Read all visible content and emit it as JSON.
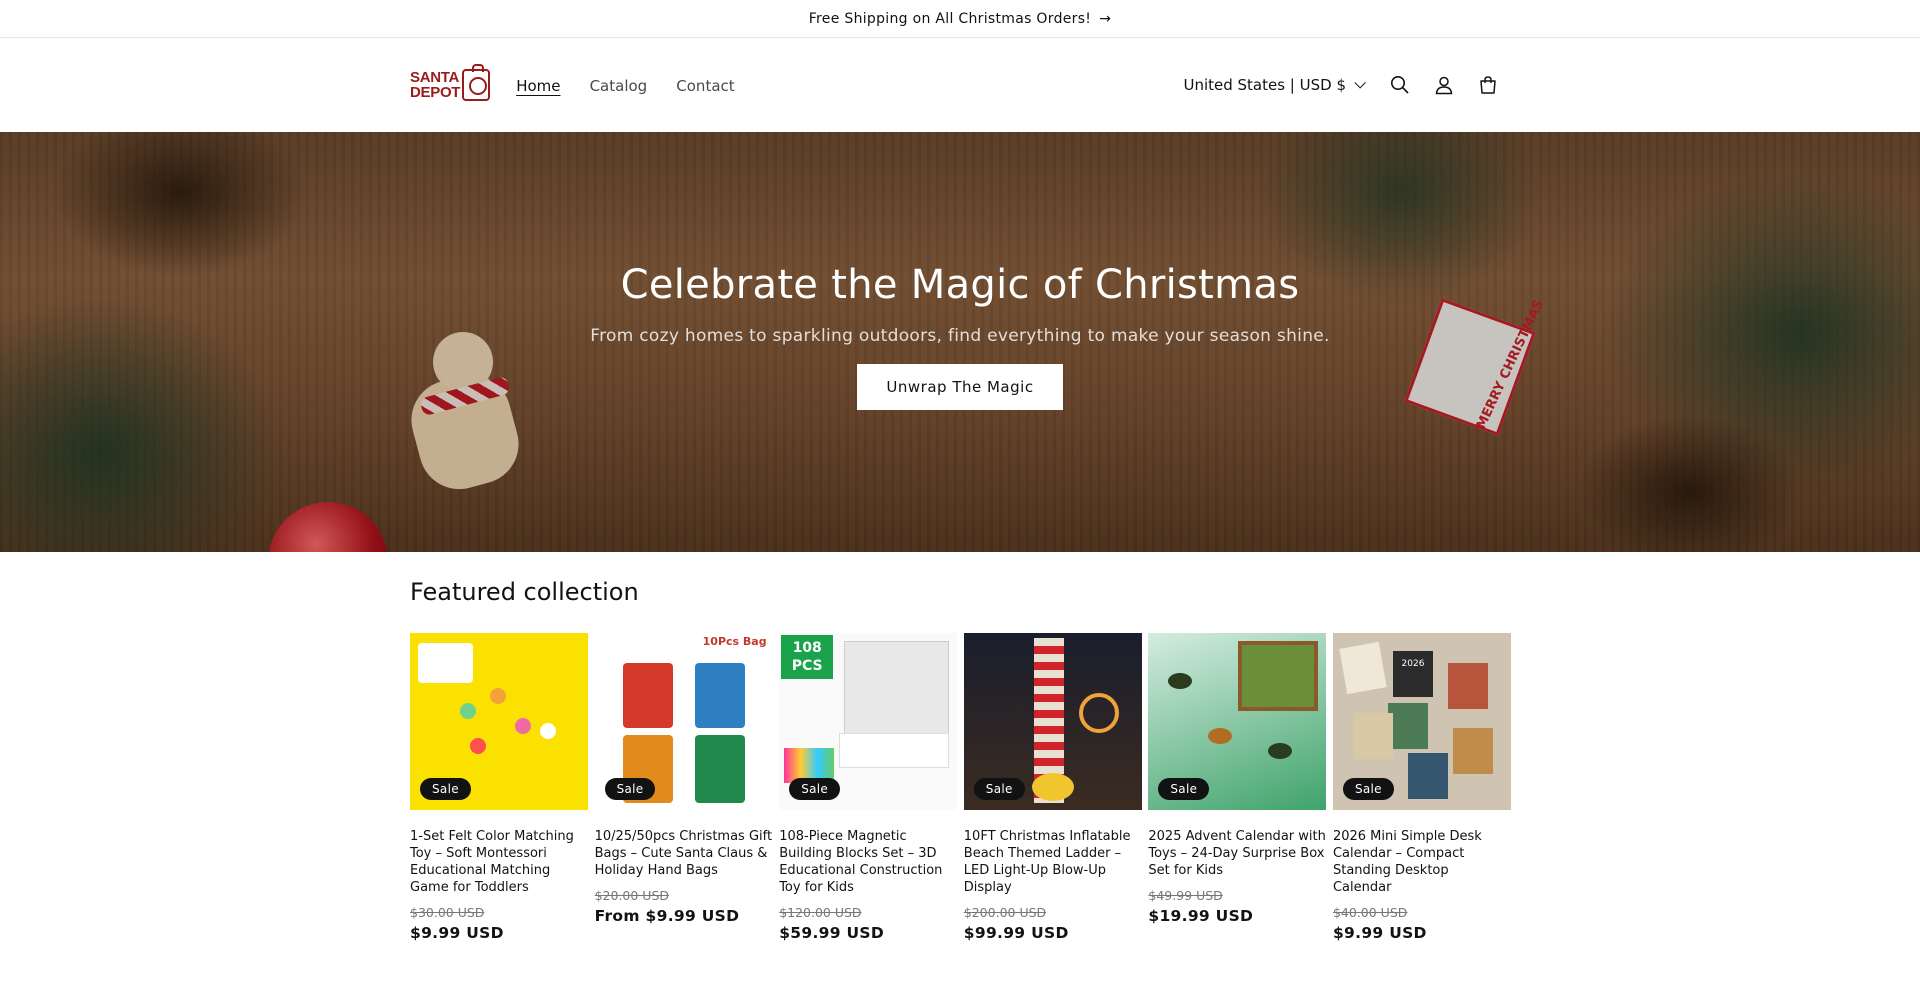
{
  "announcement": {
    "text": "Free Shipping on All Christmas Orders!",
    "arrow": "→"
  },
  "header": {
    "logo_line1": "SANTA",
    "logo_line2": "DEPOT",
    "nav": [
      {
        "label": "Home",
        "active": true
      },
      {
        "label": "Catalog",
        "active": false
      },
      {
        "label": "Contact",
        "active": false
      }
    ],
    "country": "United States | USD $",
    "icons": [
      "search-icon",
      "account-icon",
      "cart-icon"
    ]
  },
  "hero": {
    "title": "Celebrate the Magic of Christmas",
    "subtitle": "From cozy homes to sparkling outdoors, find everything to make your season shine.",
    "button": "Unwrap The Magic",
    "tag_text": "MERRY CHRISTMAS"
  },
  "featured": {
    "title": "Featured collection",
    "products": [
      {
        "badge": "Sale",
        "title": "1-Set Felt Color Matching Toy – Soft Montessori Educational Matching Game for Toddlers",
        "old_price": "$30.00 USD",
        "price": "$9.99 USD"
      },
      {
        "badge": "Sale",
        "title": "10/25/50pcs Christmas Gift Bags – Cute Santa Claus & Holiday Hand Bags",
        "old_price": "$20.00 USD",
        "price": "From $9.99 USD",
        "img_label": "10Pcs Bag"
      },
      {
        "badge": "Sale",
        "title": "108-Piece Magnetic Building Blocks Set – 3D Educational Construction Toy for Kids",
        "old_price": "$120.00 USD",
        "price": "$59.99 USD",
        "img_label": "108 PCS"
      },
      {
        "badge": "Sale",
        "title": "10FT Christmas Inflatable Beach Themed Ladder – LED Light-Up Blow-Up Display",
        "old_price": "$200.00 USD",
        "price": "$99.99 USD"
      },
      {
        "badge": "Sale",
        "title": "2025 Advent Calendar with Toys – 24-Day Surprise Box Set for Kids",
        "old_price": "$49.99 USD",
        "price": "$19.99 USD"
      },
      {
        "badge": "Sale",
        "title": "2026 Mini Simple Desk Calendar – Compact Standing Desktop Calendar",
        "old_price": "$40.00 USD",
        "price": "$9.99 USD",
        "img_label": "2026"
      }
    ]
  },
  "colors": {
    "brand": "#9b1b1b",
    "badge_bg": "#121212",
    "text": "#121212"
  }
}
